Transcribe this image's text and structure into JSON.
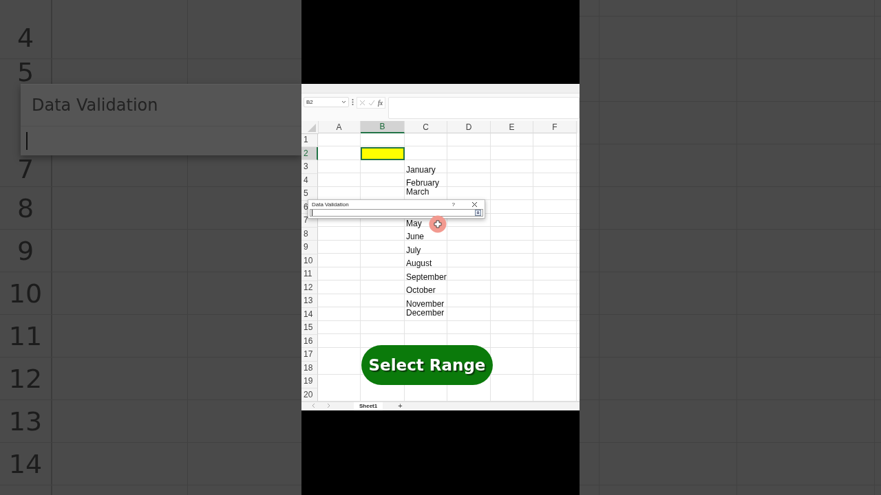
{
  "backdrop_left": {
    "items": [
      {
        "kind": "row",
        "label": "4"
      },
      {
        "kind": "row",
        "label": "5"
      },
      {
        "kind": "dialog",
        "title": "Data Validation"
      },
      {
        "kind": "row",
        "label": "7"
      },
      {
        "kind": "row",
        "label": "8"
      },
      {
        "kind": "row",
        "label": "9"
      },
      {
        "kind": "row",
        "label": "10"
      },
      {
        "kind": "row",
        "label": "11"
      },
      {
        "kind": "row",
        "label": "12"
      },
      {
        "kind": "row",
        "label": "13"
      },
      {
        "kind": "row",
        "label": "14"
      }
    ]
  },
  "spreadsheet": {
    "name_box": "B2",
    "function_label": "fx",
    "columns": [
      "A",
      "B",
      "C",
      "D",
      "E",
      "F"
    ],
    "rows": [
      {
        "header": "1"
      },
      {
        "header": "2",
        "cells": {
          "B": {
            "selected": true,
            "color": "#ffff00"
          }
        }
      },
      {
        "header": "3",
        "cells": {
          "C": {
            "text": "January",
            "selected": false
          }
        }
      },
      {
        "header": "4",
        "cells": {
          "C": {
            "text": "February",
            "selected": false
          }
        }
      },
      {
        "header": "5",
        "cells": {
          "C": {
            "text": "March",
            "selected": false
          }
        }
      },
      {
        "header": "6"
      },
      {
        "header": "7",
        "cells": {
          "C": {
            "text": "May",
            "selected": false
          }
        }
      },
      {
        "header": "8",
        "cells": {
          "C": {
            "text": "June",
            "selected": false
          }
        }
      },
      {
        "header": "9",
        "cells": {
          "C": {
            "text": "July",
            "selected": false
          }
        }
      },
      {
        "header": "10",
        "cells": {
          "C": {
            "text": "August",
            "selected": false
          }
        }
      },
      {
        "header": "11",
        "cells": {
          "C": {
            "text": "September",
            "selected": false
          }
        }
      },
      {
        "header": "12",
        "cells": {
          "C": {
            "text": "October",
            "selected": false
          }
        }
      },
      {
        "header": "13",
        "cells": {
          "C": {
            "text": "November",
            "selected": false
          }
        }
      },
      {
        "header": "14",
        "cells": {
          "C": {
            "text": "December",
            "selected": false
          }
        }
      },
      {
        "header": "15"
      },
      {
        "header": "16"
      },
      {
        "header": "17"
      },
      {
        "header": "18"
      },
      {
        "header": "19"
      },
      {
        "header": "20"
      }
    ],
    "sheet_tabs": [
      {
        "label": "Sheet1",
        "selected": true
      }
    ],
    "add_sheet": "+",
    "dialog": {
      "title": "Data Validation",
      "help": "?"
    },
    "caption": "Select Range"
  }
}
